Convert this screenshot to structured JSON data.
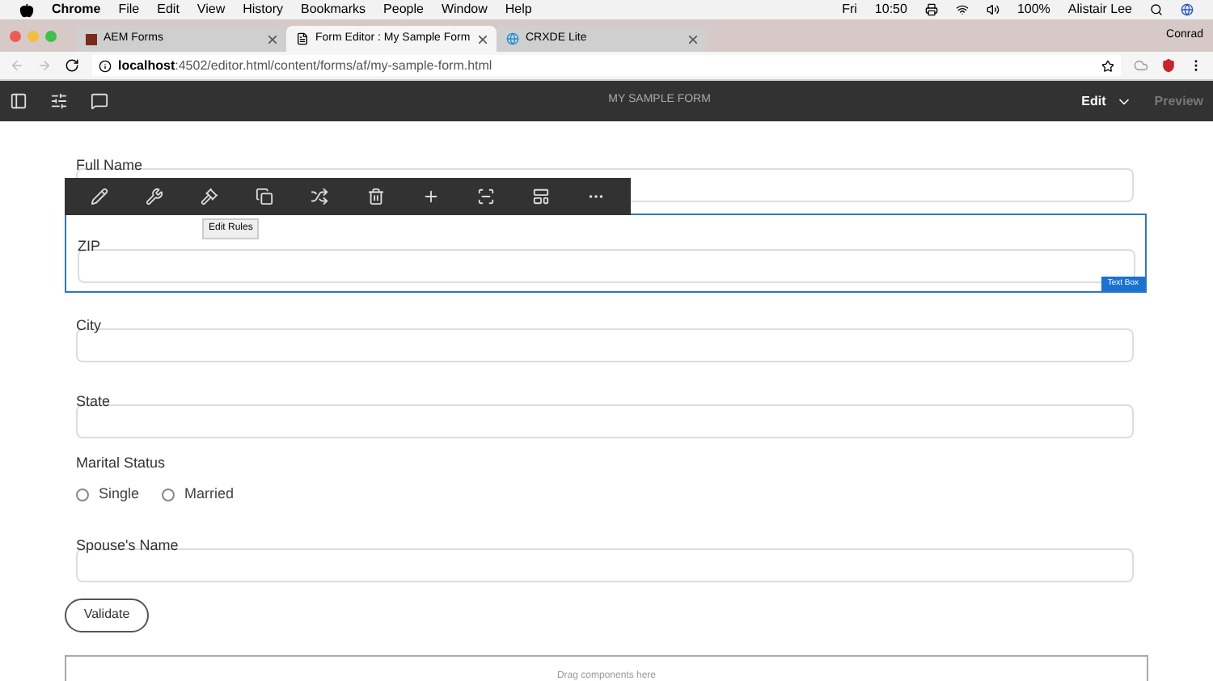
{
  "menu_bar": {
    "app": "Chrome",
    "items": [
      "File",
      "Edit",
      "View",
      "History",
      "Bookmarks",
      "People",
      "Window",
      "Help"
    ],
    "status": {
      "day": "Fri",
      "time": "10:50",
      "battery": "100%",
      "user": "Alistair Lee"
    }
  },
  "tabs": [
    {
      "title": "AEM Forms",
      "selected": false
    },
    {
      "title": "Form Editor : My Sample Form",
      "selected": true
    },
    {
      "title": "CRXDE Lite",
      "selected": false
    }
  ],
  "profile": "Conrad",
  "address": {
    "host": "localhost",
    "path": ":4502/editor.html/content/forms/af/my-sample-form.html"
  },
  "editor": {
    "title": "MY SAMPLE FORM",
    "mode": "Edit",
    "preview": "Preview"
  },
  "toolbar": {
    "tooltip": "Edit Rules"
  },
  "fields": [
    {
      "kind": "text",
      "label": "Full Name",
      "selected": false
    },
    {
      "kind": "text",
      "label": "ZIP",
      "selected": true,
      "badge": "Text Box"
    },
    {
      "kind": "text",
      "label": "City",
      "selected": false
    },
    {
      "kind": "text",
      "label": "State",
      "selected": false
    },
    {
      "kind": "radio",
      "label": "Marital Status",
      "options": [
        {
          "label": "Single",
          "checked": false
        },
        {
          "label": "Married",
          "checked": false
        }
      ]
    },
    {
      "kind": "text",
      "label": "Spouse's Name",
      "selected": false
    }
  ],
  "button": "Validate",
  "drop_zone": "Drag components here"
}
